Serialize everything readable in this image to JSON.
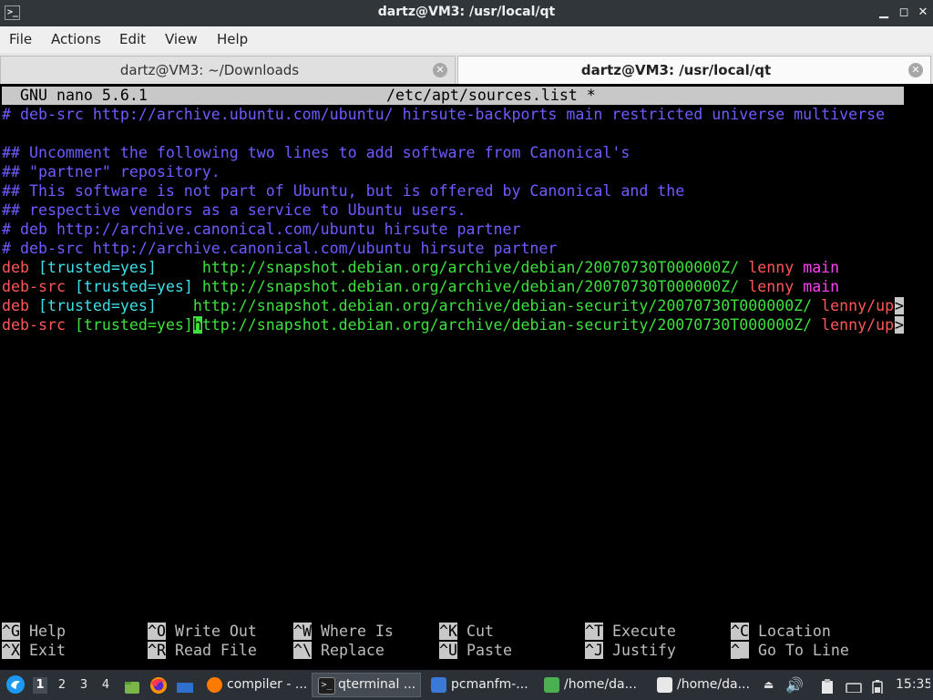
{
  "window": {
    "title": "dartz@VM3: /usr/local/qt",
    "app_icon": ">_"
  },
  "menu": [
    "File",
    "Actions",
    "Edit",
    "View",
    "Help"
  ],
  "tabs": [
    {
      "label": "dartz@VM3: ~/Downloads"
    },
    {
      "label": "dartz@VM3: /usr/local/qt"
    }
  ],
  "nano": {
    "version": "GNU nano 5.6.1",
    "filename": "/etc/apt/sources.list *",
    "lines": [
      "# deb-src http://archive.ubuntu.com/ubuntu/ hirsute-backports main restricted universe multiverse",
      "",
      "## Uncomment the following two lines to add software from Canonical's",
      "## \"partner\" repository.",
      "## This software is not part of Ubuntu, but is offered by Canonical and the",
      "## respective vendors as a service to Ubuntu users.",
      "# deb http://archive.canonical.com/ubuntu hirsute partner",
      "# deb-src http://archive.canonical.com/ubuntu hirsute partner"
    ],
    "entries": [
      {
        "type": "deb",
        "opts": "[trusted=yes]",
        "url": "http://snapshot.debian.org/archive/debian/20070730T000000Z/",
        "dist": "lenny",
        "comp": "main"
      },
      {
        "type": "deb-src",
        "opts": "[trusted=yes]",
        "url": "http://snapshot.debian.org/archive/debian/20070730T000000Z/",
        "dist": "lenny",
        "comp": "main"
      },
      {
        "type": "deb",
        "opts": "[trusted=yes]",
        "url": "http://snapshot.debian.org/archive/debian-security/20070730T000000Z/",
        "dist": "lenny/up",
        "comp": ""
      },
      {
        "type": "deb-src",
        "opts": "[trusted=yes]",
        "url": "http://snapshot.debian.org/archive/debian-security/20070730T000000Z/",
        "dist": "lenny/up",
        "comp": ""
      }
    ],
    "cursor_char": "h",
    "url_rest": "ttp://snapshot.debian.org/archive/debian-security/20070730T000000Z/",
    "overflow_mark": ">",
    "shortcuts": [
      {
        "key": "^G",
        "label": "Help"
      },
      {
        "key": "^O",
        "label": "Write Out"
      },
      {
        "key": "^W",
        "label": "Where Is"
      },
      {
        "key": "^K",
        "label": "Cut"
      },
      {
        "key": "^T",
        "label": "Execute"
      },
      {
        "key": "^C",
        "label": "Location"
      },
      {
        "key": "^X",
        "label": "Exit"
      },
      {
        "key": "^R",
        "label": "Read File"
      },
      {
        "key": "^\\",
        "label": "Replace"
      },
      {
        "key": "^U",
        "label": "Paste"
      },
      {
        "key": "^J",
        "label": "Justify"
      },
      {
        "key": "^_",
        "label": "Go To Line"
      }
    ]
  },
  "panel": {
    "desktops": [
      "1",
      "2",
      "3",
      "4"
    ],
    "tasks": [
      {
        "label": "compiler - ...",
        "icon": "firefox-icon"
      },
      {
        "label": "qterminal ...",
        "icon": "terminal-icon"
      },
      {
        "label": "pcmanfm-...",
        "icon": "folder-icon"
      },
      {
        "label": "/home/da...",
        "icon": "editor-icon"
      },
      {
        "label": "/home/da...",
        "icon": "text-editor-icon"
      }
    ],
    "clock": "15:35"
  }
}
